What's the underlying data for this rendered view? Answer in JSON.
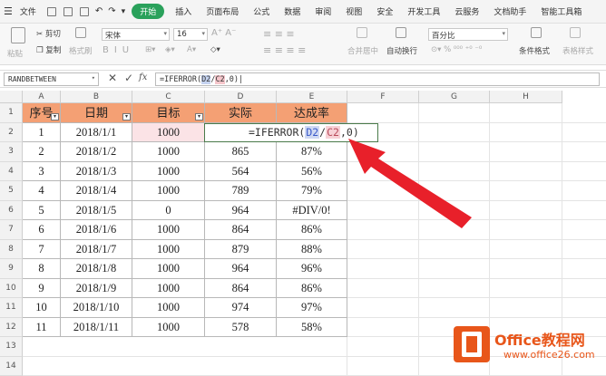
{
  "menubar": {
    "file": "文件",
    "items": [
      "插入",
      "页面布局",
      "公式",
      "数据",
      "审阅",
      "视图",
      "安全",
      "开发工具",
      "云服务",
      "文档助手",
      "智能工具箱"
    ],
    "active": "开始"
  },
  "toolbar": {
    "cut": "剪切",
    "copy": "复制",
    "format_painter": "格式刷",
    "paste": "粘贴",
    "font": "宋体",
    "size": "16",
    "merge": "合并居中",
    "wrap": "自动换行",
    "number_format": "百分比",
    "cond_format": "条件格式",
    "table_style": "表格样式"
  },
  "formula_bar": {
    "name_box": "RANDBETWEEN",
    "cancel": "✕",
    "confirm": "✓",
    "fx": "fx",
    "formula_pre": "=IFERROR(",
    "ref1": "D2",
    "slash": "/",
    "ref2": "C2",
    "formula_post": ",0)"
  },
  "columns": [
    "A",
    "B",
    "C",
    "D",
    "E",
    "F",
    "G",
    "H"
  ],
  "rows": [
    "1",
    "2",
    "3",
    "4",
    "5",
    "6",
    "7",
    "8",
    "9",
    "10",
    "11",
    "12",
    "13",
    "14"
  ],
  "table": {
    "headers": [
      "序号",
      "日期",
      "目标",
      "实际",
      "达成率"
    ],
    "data": [
      [
        "1",
        "2018/1/1",
        "1000",
        "",
        ""
      ],
      [
        "2",
        "2018/1/2",
        "1000",
        "865",
        "87%"
      ],
      [
        "3",
        "2018/1/3",
        "1000",
        "564",
        "56%"
      ],
      [
        "4",
        "2018/1/4",
        "1000",
        "789",
        "79%"
      ],
      [
        "5",
        "2018/1/5",
        "0",
        "964",
        "#DIV/0!"
      ],
      [
        "6",
        "2018/1/6",
        "1000",
        "864",
        "86%"
      ],
      [
        "7",
        "2018/1/7",
        "1000",
        "879",
        "88%"
      ],
      [
        "8",
        "2018/1/8",
        "1000",
        "964",
        "96%"
      ],
      [
        "9",
        "2018/1/9",
        "1000",
        "864",
        "86%"
      ],
      [
        "10",
        "2018/1/10",
        "1000",
        "974",
        "97%"
      ],
      [
        "11",
        "2018/1/11",
        "1000",
        "578",
        "58%"
      ]
    ]
  },
  "edit_cell": {
    "pre": "=IFERROR(",
    "ref1": "D2",
    "slash": "/",
    "ref2": "C2",
    "post": ",0)"
  },
  "watermark": {
    "title": "Office教程网",
    "url": "www.office26.com"
  },
  "colors": {
    "accent": "#2aa15b",
    "header_fill": "#f4a074",
    "arrow": "#e8202a",
    "logo": "#e8561a"
  }
}
